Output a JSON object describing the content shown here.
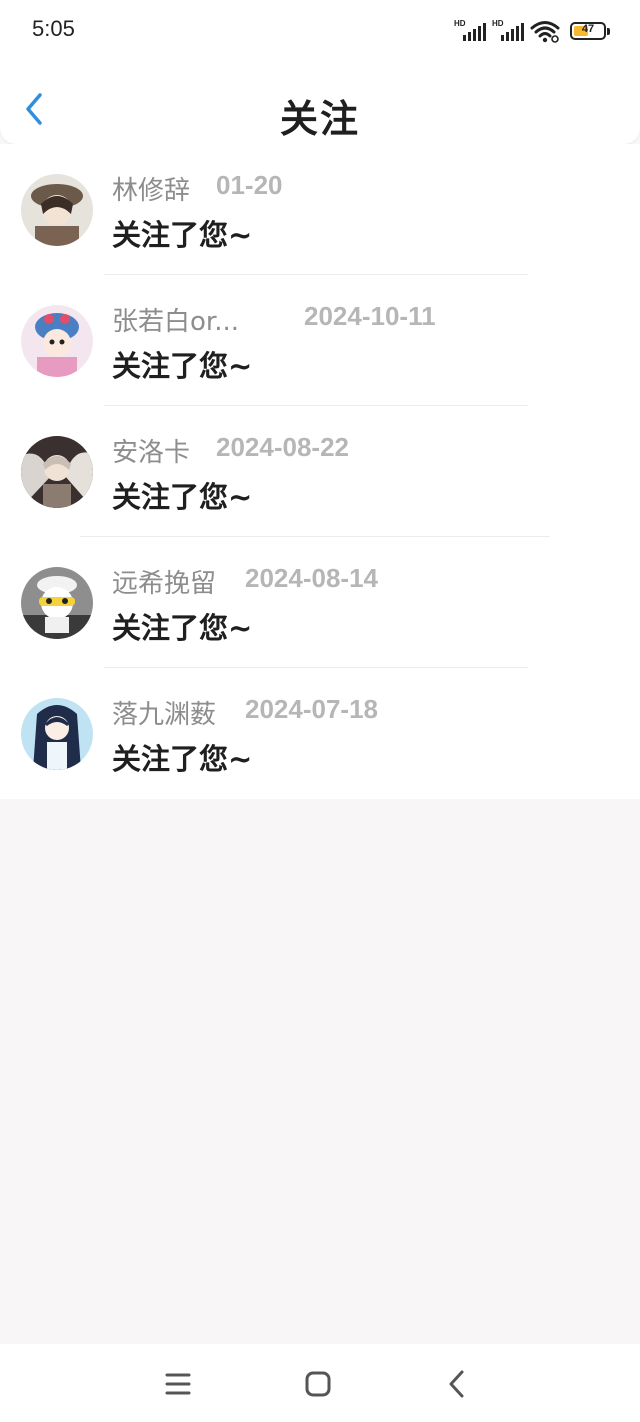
{
  "status": {
    "time": "5:05",
    "hd1": "HD",
    "hd2": "HD",
    "battery": "47"
  },
  "header": {
    "title": "关注"
  },
  "items": [
    {
      "name": "林修辞",
      "date": "01-20",
      "message": "关注了您~"
    },
    {
      "name": "张若白or...",
      "date": "2024-10-11",
      "message": "关注了您~"
    },
    {
      "name": "安洛卡",
      "date": "2024-08-22",
      "message": "关注了您~"
    },
    {
      "name": "远希挽留",
      "date": "2024-08-14",
      "message": "关注了您~"
    },
    {
      "name": "落九渊薮",
      "date": "2024-07-18",
      "message": "关注了您~"
    }
  ],
  "colors": {
    "accent": "#2f8fdd",
    "battery_fill": "#f5b82e"
  }
}
